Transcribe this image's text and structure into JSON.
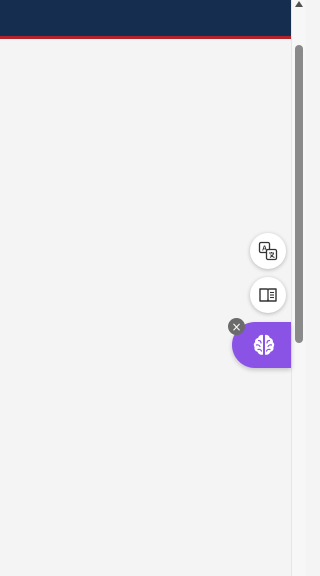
{
  "header": {
    "background_color": "#152d4f",
    "accent_line_color": "#b3232b"
  },
  "floating_tools": {
    "translate": {
      "icon": "translate-icon"
    },
    "reader": {
      "icon": "book-open-icon"
    },
    "assistant": {
      "icon": "brain-icon",
      "color": "#8a53e6"
    },
    "close": {
      "label": "×",
      "icon": "close-icon"
    }
  }
}
